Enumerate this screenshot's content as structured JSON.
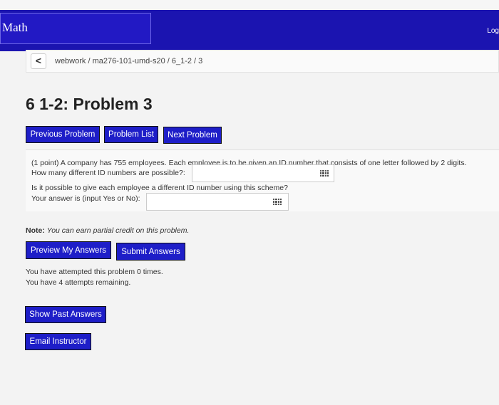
{
  "header": {
    "logo": "Math",
    "logout": "Log"
  },
  "breadcrumb": {
    "back_glyph": "<",
    "path": "webwork / ma276-101-umd-s20 / 6_1-2 / 3"
  },
  "page_title": "6 1-2: Problem 3",
  "nav": {
    "previous": "Previous Problem",
    "list": "Problem List",
    "next": "Next Problem"
  },
  "problem": {
    "line1": "(1 point) A company has 755 employees. Each employee is to be given an ID number that consists of one letter followed by 2 digits.",
    "q1": "How many different ID numbers are possible?:",
    "q1_value": "",
    "line2": "Is it possible to give each employee a different ID number using this scheme?",
    "q2": "Your answer is (input Yes or No):",
    "q2_value": ""
  },
  "note": {
    "label": "Note:",
    "text": "You can earn partial credit on this problem."
  },
  "actions": {
    "preview": "Preview My Answers",
    "submit": "Submit Answers"
  },
  "attempts": {
    "line1": "You have attempted this problem 0 times.",
    "line2": "You have 4 attempts remaining."
  },
  "buttons": {
    "show_past": "Show Past Answers",
    "email": "Email Instructor"
  },
  "colors": {
    "header_bg": "#1b14b0",
    "button_bg": "#1e1ec8"
  },
  "icons": [
    "grid-icon"
  ]
}
